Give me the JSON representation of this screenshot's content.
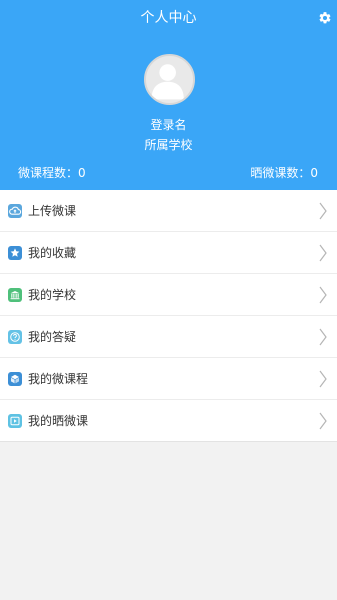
{
  "header": {
    "title": "个人中心",
    "username": "登录名",
    "school": "所属学校",
    "stat_left": "微课程数：0",
    "stat_right": "晒微课数：0",
    "background_color": "#3aa6f7",
    "settings_icon": "gear-icon",
    "avatar_icon": "default-user-avatar"
  },
  "menu": {
    "items": [
      {
        "label": "上传微课",
        "icon": "upload-cloud-icon",
        "color": "#5ba7dd"
      },
      {
        "label": "我的收藏",
        "icon": "star-icon",
        "color": "#3c8fd6"
      },
      {
        "label": "我的学校",
        "icon": "school-building-icon",
        "color": "#4fc07b"
      },
      {
        "label": "我的答疑",
        "icon": "question-icon",
        "color": "#64c2e6"
      },
      {
        "label": "我的微课程",
        "icon": "course-cube-icon",
        "color": "#3c8fd6"
      },
      {
        "label": "我的晒微课",
        "icon": "play-video-icon",
        "color": "#5ec2e3"
      }
    ],
    "chevron_icon": "chevron-right-icon"
  }
}
